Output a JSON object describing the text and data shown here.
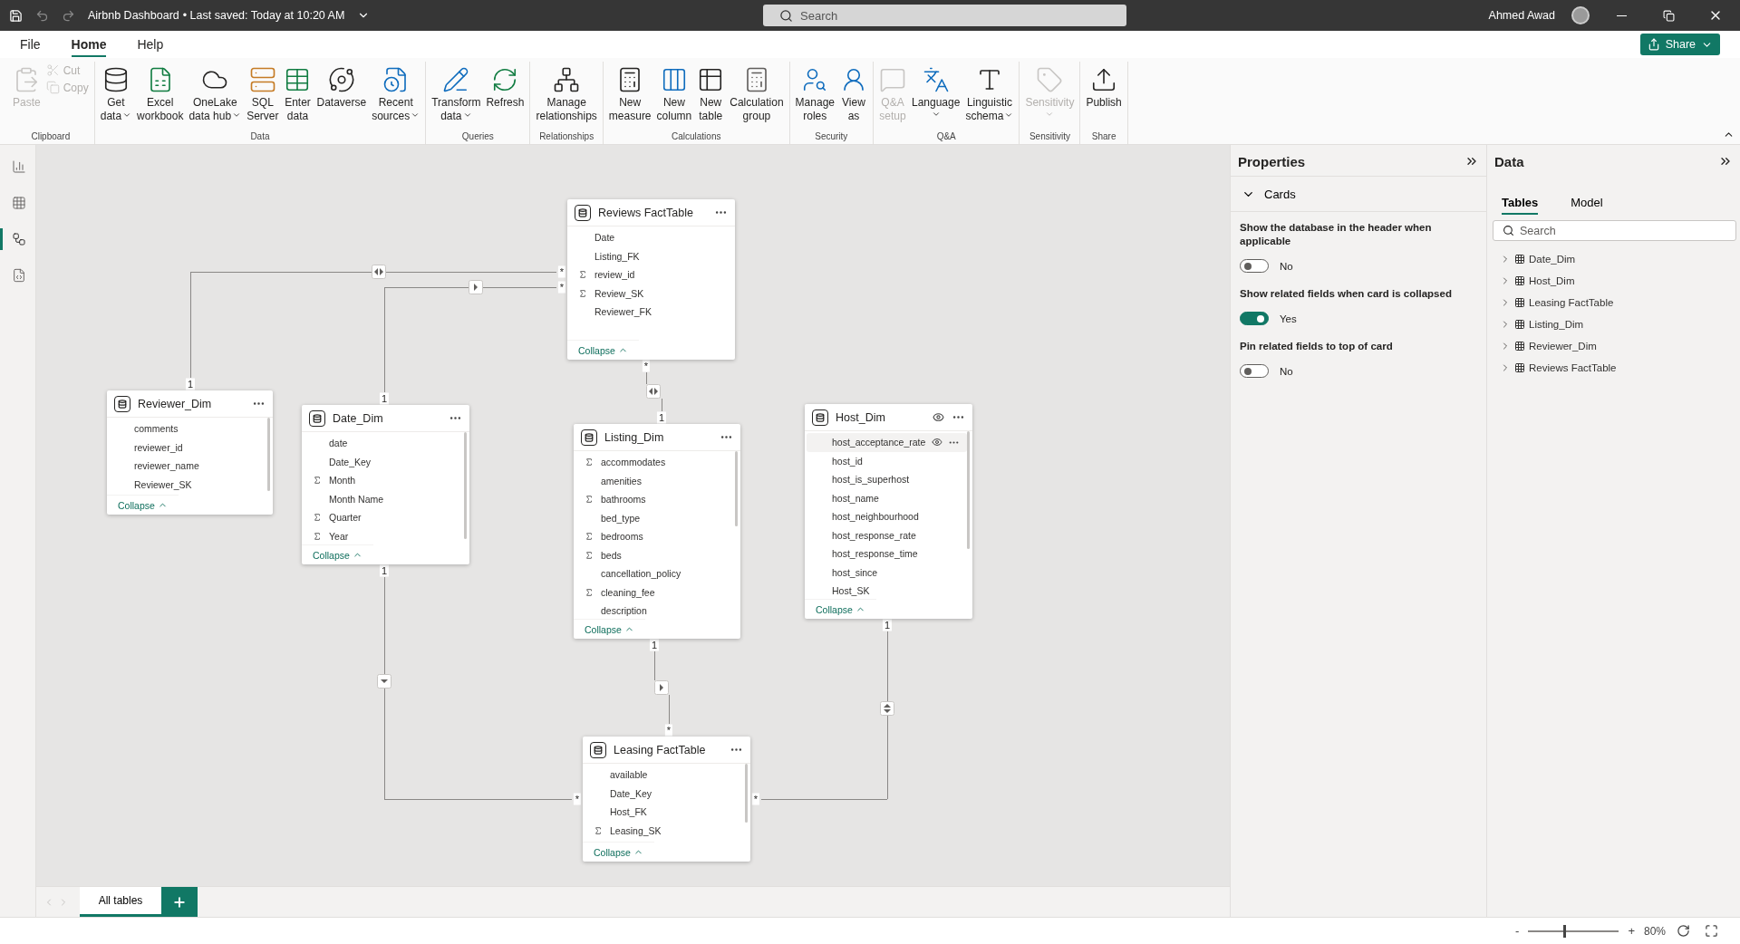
{
  "title_bar": {
    "title": "Airbnb Dashboard",
    "saved": "• Last saved: Today at 10:20 AM",
    "search_placeholder": "Search",
    "user": "Ahmed Awad"
  },
  "menu_tabs": [
    {
      "label": "File",
      "selected": false
    },
    {
      "label": "Home",
      "selected": true
    },
    {
      "label": "Help",
      "selected": false
    }
  ],
  "share_button": "Share",
  "ribbon": [
    {
      "label": "Clipboard",
      "items": [
        {
          "lines": [
            "Paste"
          ],
          "kind": "large",
          "disabled": true,
          "dropdown": false
        },
        {
          "lines": [
            "Cut"
          ],
          "kind": "small",
          "disabled": true,
          "dropdown": false
        },
        {
          "lines": [
            "Copy"
          ],
          "kind": "small",
          "disabled": true,
          "dropdown": false
        }
      ]
    },
    {
      "label": "Data",
      "items": [
        {
          "lines": [
            "Get",
            "data"
          ],
          "kind": "large",
          "disabled": false,
          "dropdown": true
        },
        {
          "lines": [
            "Excel",
            "workbook"
          ],
          "kind": "large",
          "disabled": false,
          "dropdown": false
        },
        {
          "lines": [
            "OneLake",
            "data hub"
          ],
          "kind": "large",
          "disabled": false,
          "dropdown": true
        },
        {
          "lines": [
            "SQL",
            "Server"
          ],
          "kind": "large",
          "disabled": false,
          "dropdown": false
        },
        {
          "lines": [
            "Enter",
            "data"
          ],
          "kind": "large",
          "disabled": false,
          "dropdown": false
        },
        {
          "lines": [
            "Dataverse"
          ],
          "kind": "large",
          "disabled": false,
          "dropdown": false
        },
        {
          "lines": [
            "Recent",
            "sources"
          ],
          "kind": "large",
          "disabled": false,
          "dropdown": true
        }
      ]
    },
    {
      "label": "Queries",
      "items": [
        {
          "lines": [
            "Transform",
            "data"
          ],
          "kind": "large",
          "disabled": false,
          "dropdown": true
        },
        {
          "lines": [
            "Refresh"
          ],
          "kind": "large",
          "disabled": false,
          "dropdown": false
        }
      ]
    },
    {
      "label": "Relationships",
      "items": [
        {
          "lines": [
            "Manage",
            "relationships"
          ],
          "kind": "large",
          "disabled": false,
          "dropdown": false
        }
      ]
    },
    {
      "label": "Calculations",
      "items": [
        {
          "lines": [
            "New",
            "measure"
          ],
          "kind": "large",
          "disabled": false,
          "dropdown": false
        },
        {
          "lines": [
            "New",
            "column"
          ],
          "kind": "large",
          "disabled": false,
          "dropdown": false
        },
        {
          "lines": [
            "New",
            "table"
          ],
          "kind": "large",
          "disabled": false,
          "dropdown": false
        },
        {
          "lines": [
            "Calculation",
            "group"
          ],
          "kind": "large",
          "disabled": false,
          "dropdown": false
        }
      ]
    },
    {
      "label": "Security",
      "items": [
        {
          "lines": [
            "Manage",
            "roles"
          ],
          "kind": "large",
          "disabled": false,
          "dropdown": false
        },
        {
          "lines": [
            "View",
            "as"
          ],
          "kind": "large",
          "disabled": false,
          "dropdown": false
        }
      ]
    },
    {
      "label": "Q&A",
      "items": [
        {
          "lines": [
            "Q&A",
            "setup"
          ],
          "kind": "large",
          "disabled": true,
          "dropdown": false
        },
        {
          "lines": [
            "Language"
          ],
          "kind": "large",
          "disabled": false,
          "dropdown": true
        },
        {
          "lines": [
            "Linguistic",
            "schema"
          ],
          "kind": "large",
          "disabled": false,
          "dropdown": true
        }
      ]
    },
    {
      "label": "Sensitivity",
      "items": [
        {
          "lines": [
            "Sensitivity"
          ],
          "kind": "large",
          "disabled": true,
          "dropdown": true
        }
      ]
    },
    {
      "label": "Share",
      "items": [
        {
          "lines": [
            "Publish"
          ],
          "kind": "large",
          "disabled": false,
          "dropdown": false
        }
      ]
    }
  ],
  "nav": [
    {
      "selected": false
    },
    {
      "selected": false
    },
    {
      "selected": true
    },
    {
      "selected": false
    }
  ],
  "tables": [
    {
      "name": "Reviews FactTable",
      "eye": false,
      "collapse": "Collapse",
      "fields": [
        {
          "name": "Date",
          "sum": false,
          "hovered": false
        },
        {
          "name": "Listing_FK",
          "sum": false,
          "hovered": false
        },
        {
          "name": "review_id",
          "sum": true,
          "hovered": false
        },
        {
          "name": "Review_SK",
          "sum": true,
          "hovered": false
        },
        {
          "name": "Reviewer_FK",
          "sum": false,
          "hovered": false
        }
      ]
    },
    {
      "name": "Reviewer_Dim",
      "eye": false,
      "collapse": "Collapse",
      "fields": [
        {
          "name": "comments",
          "sum": false,
          "hovered": false
        },
        {
          "name": "reviewer_id",
          "sum": false,
          "hovered": false
        },
        {
          "name": "reviewer_name",
          "sum": false,
          "hovered": false
        },
        {
          "name": "Reviewer_SK",
          "sum": false,
          "hovered": false
        }
      ]
    },
    {
      "name": "Date_Dim",
      "eye": false,
      "collapse": "Collapse",
      "fields": [
        {
          "name": "date",
          "sum": false,
          "hovered": false
        },
        {
          "name": "Date_Key",
          "sum": false,
          "hovered": false
        },
        {
          "name": "Month",
          "sum": true,
          "hovered": false
        },
        {
          "name": "Month Name",
          "sum": false,
          "hovered": false
        },
        {
          "name": "Quarter",
          "sum": true,
          "hovered": false
        },
        {
          "name": "Year",
          "sum": true,
          "hovered": false
        }
      ]
    },
    {
      "name": "Listing_Dim",
      "eye": false,
      "collapse": "Collapse",
      "fields": [
        {
          "name": "accommodates",
          "sum": true,
          "hovered": false
        },
        {
          "name": "amenities",
          "sum": false,
          "hovered": false
        },
        {
          "name": "bathrooms",
          "sum": true,
          "hovered": false
        },
        {
          "name": "bed_type",
          "sum": false,
          "hovered": false
        },
        {
          "name": "bedrooms",
          "sum": true,
          "hovered": false
        },
        {
          "name": "beds",
          "sum": true,
          "hovered": false
        },
        {
          "name": "cancellation_policy",
          "sum": false,
          "hovered": false
        },
        {
          "name": "cleaning_fee",
          "sum": true,
          "hovered": false
        },
        {
          "name": "description",
          "sum": false,
          "hovered": false
        }
      ]
    },
    {
      "name": "Host_Dim",
      "eye": true,
      "collapse": "Collapse",
      "fields": [
        {
          "name": "host_acceptance_rate",
          "sum": false,
          "hovered": true
        },
        {
          "name": "host_id",
          "sum": false,
          "hovered": false
        },
        {
          "name": "host_is_superhost",
          "sum": false,
          "hovered": false
        },
        {
          "name": "host_name",
          "sum": false,
          "hovered": false
        },
        {
          "name": "host_neighbourhood",
          "sum": false,
          "hovered": false
        },
        {
          "name": "host_response_rate",
          "sum": false,
          "hovered": false
        },
        {
          "name": "host_response_time",
          "sum": false,
          "hovered": false
        },
        {
          "name": "host_since",
          "sum": false,
          "hovered": false
        },
        {
          "name": "Host_SK",
          "sum": false,
          "hovered": false
        }
      ]
    },
    {
      "name": "Leasing FactTable",
      "eye": false,
      "collapse": "Collapse",
      "fields": [
        {
          "name": "available",
          "sum": false,
          "hovered": false
        },
        {
          "name": "Date_Key",
          "sum": false,
          "hovered": false
        },
        {
          "name": "Host_FK",
          "sum": false,
          "hovered": false
        },
        {
          "name": "Leasing_SK",
          "sum": true,
          "hovered": false
        }
      ]
    }
  ],
  "relationships": [
    {
      "from_cardinality": "1",
      "to_cardinality": "*",
      "bidirectional": true
    },
    {
      "from_cardinality": "1",
      "to_cardinality": "*",
      "bidirectional": false
    },
    {
      "from_cardinality": "1",
      "to_cardinality": "*",
      "bidirectional": false
    },
    {
      "from_cardinality": "*",
      "to_cardinality": "1",
      "bidirectional": true
    },
    {
      "from_cardinality": "1",
      "to_cardinality": "*",
      "bidirectional": false
    },
    {
      "from_cardinality": "1",
      "to_cardinality": "*",
      "bidirectional": true
    }
  ],
  "page_tabs": [
    {
      "label": "All tables",
      "selected": true
    }
  ],
  "properties": {
    "title": "Properties",
    "section": "Cards",
    "settings": [
      {
        "label": "Show the database in the header when applicable",
        "on": false,
        "value": "No"
      },
      {
        "label": "Show related fields when card is collapsed",
        "on": true,
        "value": "Yes"
      },
      {
        "label": "Pin related fields to top of card",
        "on": false,
        "value": "No"
      }
    ]
  },
  "data_pane": {
    "title": "Data",
    "tabs": [
      {
        "label": "Tables",
        "selected": true
      },
      {
        "label": "Model",
        "selected": false
      }
    ],
    "search_placeholder": "Search",
    "tables": [
      "Date_Dim",
      "Host_Dim",
      "Leasing FactTable",
      "Listing_Dim",
      "Reviewer_Dim",
      "Reviews FactTable"
    ]
  },
  "status_bar": {
    "zoom_minus": "-",
    "zoom_plus": "+",
    "zoom": "80%",
    "zoom_slider": {
      "level": 0.39
    }
  }
}
